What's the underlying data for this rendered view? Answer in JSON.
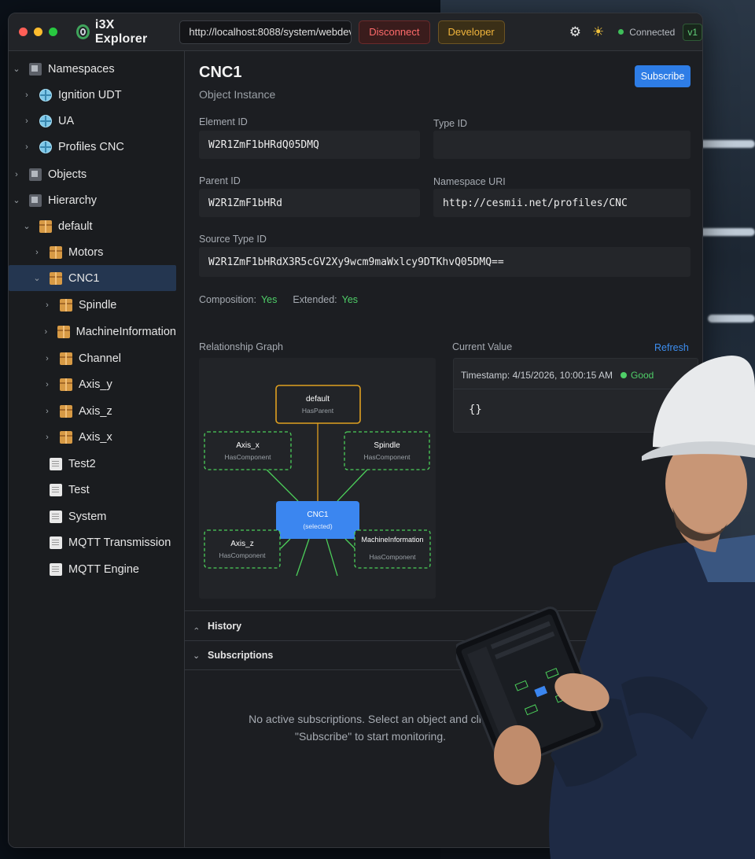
{
  "app": {
    "title": "i3X Explorer",
    "url": "http://localhost:8088/system/webdev/i3x",
    "disconnect_label": "Disconnect",
    "developer_label": "Developer",
    "status_label": "Connected",
    "version": "v1",
    "colors": {
      "accent": "#2e7de6",
      "good": "#4fcf68",
      "warning": "#f2b53c",
      "danger": "#ff6b6b"
    }
  },
  "sidebar": {
    "items": [
      {
        "label": "Namespaces",
        "chev": "⌄",
        "icon": "hourglass-icon",
        "level": 0
      },
      {
        "label": "Ignition UDT",
        "chev": "›",
        "icon": "globe-icon",
        "level": 1
      },
      {
        "label": "UA",
        "chev": "›",
        "icon": "globe-icon",
        "level": 1
      },
      {
        "label": "Profiles CNC",
        "chev": "›",
        "icon": "globe-icon",
        "level": 1
      },
      {
        "label": "Objects",
        "chev": "›",
        "icon": "folder-icon",
        "level": 0
      },
      {
        "label": "Hierarchy",
        "chev": "⌄",
        "icon": "folder-icon",
        "level": 0
      },
      {
        "label": "default",
        "chev": "⌄",
        "icon": "box-icon",
        "level": 1
      },
      {
        "label": "Motors",
        "chev": "›",
        "icon": "box-icon",
        "level": 2
      },
      {
        "label": "CNC1",
        "chev": "⌄",
        "icon": "box-icon",
        "level": 2,
        "selected": true
      },
      {
        "label": "Spindle",
        "chev": "›",
        "icon": "box-icon",
        "level": 3
      },
      {
        "label": "MachineInformation",
        "chev": "›",
        "icon": "box-icon",
        "level": 3
      },
      {
        "label": "Channel",
        "chev": "›",
        "icon": "box-icon",
        "level": 3
      },
      {
        "label": "Axis_y",
        "chev": "›",
        "icon": "box-icon",
        "level": 3
      },
      {
        "label": "Axis_z",
        "chev": "›",
        "icon": "box-icon",
        "level": 3
      },
      {
        "label": "Axis_x",
        "chev": "›",
        "icon": "box-icon",
        "level": 3
      },
      {
        "label": "Test2",
        "chev": "",
        "icon": "document-icon",
        "level": 2
      },
      {
        "label": "Test",
        "chev": "",
        "icon": "document-icon",
        "level": 2
      },
      {
        "label": "System",
        "chev": "",
        "icon": "document-icon",
        "level": 2
      },
      {
        "label": "MQTT Transmission",
        "chev": "",
        "icon": "document-icon",
        "level": 2
      },
      {
        "label": "MQTT Engine",
        "chev": "",
        "icon": "document-icon",
        "level": 2
      }
    ]
  },
  "object": {
    "title": "CNC1",
    "subtitle": "Object Instance",
    "subscribe_label": "Subscribe",
    "element_id_label": "Element ID",
    "element_id": "W2R1ZmF1bHRdQ05DMQ",
    "type_id_label": "Type ID",
    "type_id": "",
    "parent_id_label": "Parent ID",
    "parent_id": "W2R1ZmF1bHRd",
    "namespace_uri_label": "Namespace URI",
    "namespace_uri": "http://cesmii.net/profiles/CNC",
    "source_type_id_label": "Source Type ID",
    "source_type_id": "W2R1ZmF1bHRdX3R5cGV2Xy9wcm9maWxlcy9DTKhvQ05DMQ==",
    "composition_label": "Composition:",
    "composition_value": "Yes",
    "extended_label": "Extended:",
    "extended_value": "Yes"
  },
  "graph": {
    "title": "Relationship Graph",
    "parent": {
      "name": "default",
      "rel": "HasParent"
    },
    "center": {
      "name": "CNC1",
      "rel": "(selected)"
    },
    "components": [
      {
        "name": "Axis_x",
        "rel": "HasComponent"
      },
      {
        "name": "Spindle",
        "rel": "HasComponent"
      },
      {
        "name": "Axis_z",
        "rel": "HasComponent"
      },
      {
        "name": "MachineInformation",
        "rel": "HasComponent"
      }
    ]
  },
  "current_value": {
    "title": "Current Value",
    "refresh_label": "Refresh",
    "timestamp": "Timestamp: 4/15/2026, 10:00:15 AM",
    "quality": "Good",
    "json": "{}"
  },
  "history": {
    "label": "History",
    "chev": "›"
  },
  "subscriptions": {
    "label": "Subscriptions",
    "chev": "⌄",
    "empty_line1": "No active subscriptions. Select an object and click",
    "empty_line2": "\"Subscribe\" to start monitoring."
  }
}
